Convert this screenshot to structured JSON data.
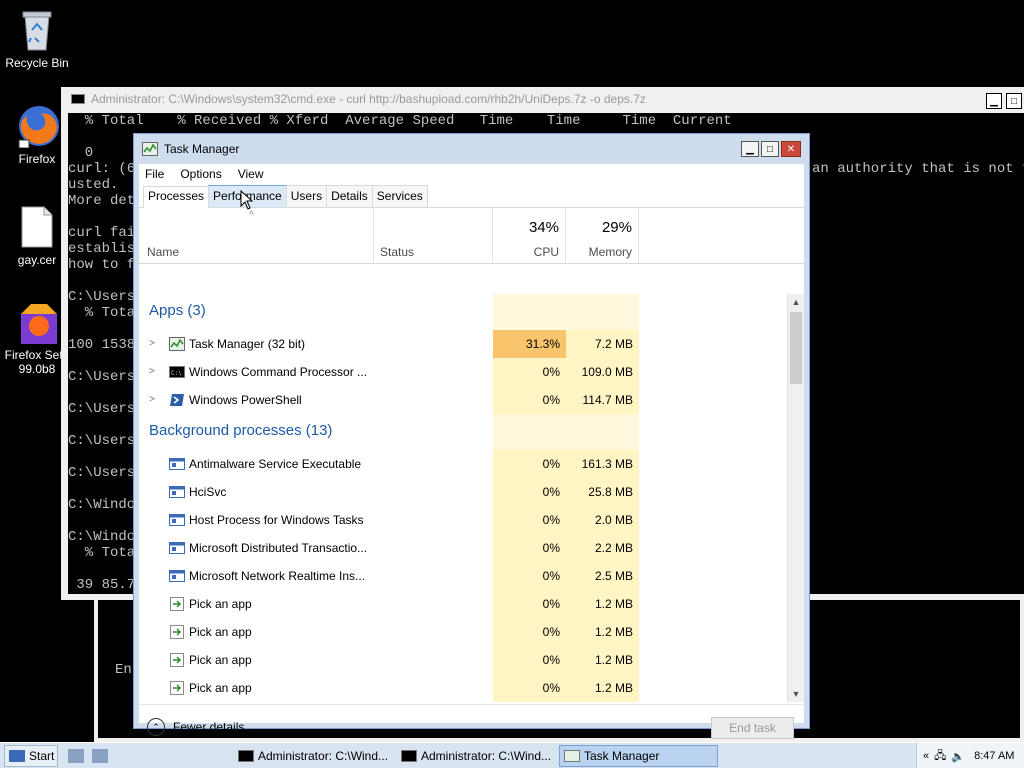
{
  "desktop": {
    "icons": [
      {
        "label": "Recycle Bin"
      },
      {
        "label": "Firefox"
      },
      {
        "label": "gay.cer"
      },
      {
        "label": "Firefox Setu\n99.0b8",
        "line1": "Firefox Setu",
        "line2": "99.0b8"
      }
    ]
  },
  "cmd": {
    "title": "Administrator: C:\\Windows\\system32\\cmd.exe - curl  http://bashupload.com/rhb2h/UniDeps.7z -o deps.7z",
    "lines": [
      "  % Total    % Received % Xferd  Average Speed   Time    Time     Time  Current",
      "",
      "  0",
      "curl: (6",
      "usted.",
      "More det",
      "",
      "curl fai",
      "establis",
      "how to f",
      "",
      "C:\\Users",
      "  % Tota",
      "",
      "100 1538",
      "",
      "C:\\Users",
      "",
      "C:\\Users",
      "",
      "C:\\Users",
      "",
      "C:\\Users",
      "",
      "C:\\Windo",
      "",
      "C:\\Windo",
      "  % Tota",
      "",
      " 39 85.7"
    ],
    "right_text": "an authority that is not tr"
  },
  "cmd_back": {
    "line": "En"
  },
  "taskmanager": {
    "title": "Task Manager",
    "menu": [
      "File",
      "Options",
      "View"
    ],
    "tabs": [
      "Processes",
      "Performance",
      "Users",
      "Details",
      "Services"
    ],
    "columns": {
      "name": "Name",
      "status": "Status",
      "cpu_pct": "34%",
      "cpu": "CPU",
      "mem_pct": "29%",
      "mem": "Memory"
    },
    "apps_group": "Apps (3)",
    "apps": [
      {
        "name": "Task Manager (32 bit)",
        "cpu": "31.3%",
        "mem": "7.2 MB"
      },
      {
        "name": "Windows Command Processor ...",
        "cpu": "0%",
        "mem": "109.0 MB"
      },
      {
        "name": "Windows PowerShell",
        "cpu": "0%",
        "mem": "114.7 MB"
      }
    ],
    "bg_group": "Background processes (13)",
    "bg": [
      {
        "name": "Antimalware Service Executable",
        "cpu": "0%",
        "mem": "161.3 MB"
      },
      {
        "name": "HciSvc",
        "cpu": "0%",
        "mem": "25.8 MB"
      },
      {
        "name": "Host Process for Windows Tasks",
        "cpu": "0%",
        "mem": "2.0 MB"
      },
      {
        "name": "Microsoft Distributed Transactio...",
        "cpu": "0%",
        "mem": "2.2 MB"
      },
      {
        "name": "Microsoft Network Realtime Ins...",
        "cpu": "0%",
        "mem": "2.5 MB"
      },
      {
        "name": "Pick an app",
        "cpu": "0%",
        "mem": "1.2 MB"
      },
      {
        "name": "Pick an app",
        "cpu": "0%",
        "mem": "1.2 MB"
      },
      {
        "name": "Pick an app",
        "cpu": "0%",
        "mem": "1.2 MB"
      },
      {
        "name": "Pick an app",
        "cpu": "0%",
        "mem": "1.2 MB"
      }
    ],
    "fewer_details": "Fewer details",
    "end_task": "End task"
  },
  "taskbar": {
    "start": "Start",
    "buttons": [
      "Administrator: C:\\Wind...",
      "Administrator: C:\\Wind...",
      "Task Manager"
    ],
    "clock": "8:47 AM"
  }
}
